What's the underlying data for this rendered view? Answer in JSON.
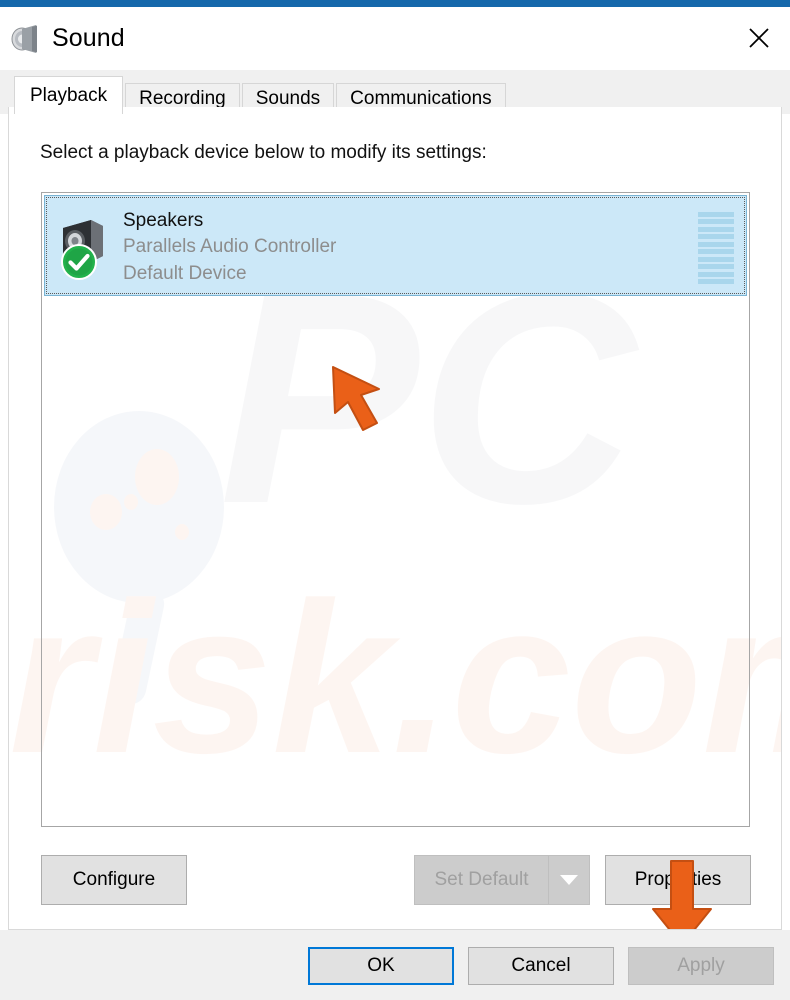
{
  "window": {
    "title": "Sound",
    "title_icon": "speaker-icon",
    "close_label": "✕",
    "accent_color": "#1568ab"
  },
  "tabs": [
    {
      "label": "Playback",
      "active": true
    },
    {
      "label": "Recording",
      "active": false
    },
    {
      "label": "Sounds",
      "active": false
    },
    {
      "label": "Communications",
      "active": false
    }
  ],
  "main": {
    "instruction": "Select a playback device below to modify its settings:",
    "devices": [
      {
        "name": "Speakers",
        "driver": "Parallels Audio Controller",
        "status": "Default Device",
        "selected": true,
        "icon": "speaker-device-icon",
        "badge": "green-check-icon",
        "meter_segments": 10
      }
    ]
  },
  "buttons": {
    "configure": {
      "label": "Configure",
      "disabled": false
    },
    "set_default": {
      "label": "Set Default",
      "disabled": true,
      "has_dropdown": true
    },
    "properties": {
      "label": "Properties",
      "disabled": false
    }
  },
  "footer": {
    "ok": {
      "label": "OK",
      "disabled": false,
      "focused": true
    },
    "cancel": {
      "label": "Cancel",
      "disabled": false
    },
    "apply": {
      "label": "Apply",
      "disabled": true
    }
  },
  "watermark": {
    "text_top": "PC",
    "text_bottom": "risk.com"
  },
  "annotations": [
    {
      "name": "arrow-pointing-at-device",
      "direction": "up-left",
      "color": "#ea6018"
    },
    {
      "name": "arrow-pointing-at-properties",
      "direction": "down",
      "color": "#ea6018"
    }
  ]
}
